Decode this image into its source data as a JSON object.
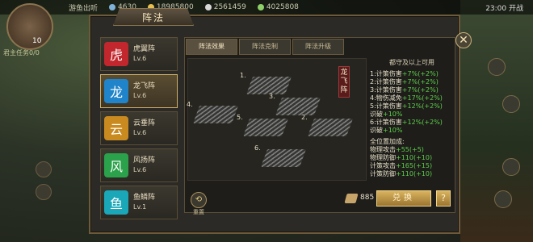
{
  "topbar": {
    "label": "游鱼出听",
    "res1": "4630",
    "res2": "18985800",
    "res3": "2561459",
    "res4": "4025808",
    "time": "23:00 开战"
  },
  "left": {
    "level": "10",
    "task": "君主任务0/0"
  },
  "panel": {
    "title": "阵法"
  },
  "formations": [
    {
      "name": "虎翼阵",
      "level": "Lv.6",
      "color": "#c1272d",
      "glyph": "虎"
    },
    {
      "name": "龙飞阵",
      "level": "Lv.6",
      "color": "#1f84c9",
      "glyph": "龙"
    },
    {
      "name": "云垂阵",
      "level": "Lv.6",
      "color": "#c98a1f",
      "glyph": "云"
    },
    {
      "name": "风扬阵",
      "level": "Lv.6",
      "color": "#2aa14a",
      "glyph": "风"
    },
    {
      "name": "鱼鳞阵",
      "level": "Lv.1",
      "color": "#1aa7b8",
      "glyph": "鱼"
    }
  ],
  "tabs": [
    "阵法效果",
    "阵法克制",
    "阵法升级"
  ],
  "formation_label": "龙飞阵",
  "positions": [
    "1.",
    "2.",
    "3.",
    "4.",
    "5.",
    "6."
  ],
  "stats": {
    "title": "都守及以上可用",
    "lines": [
      {
        "label": "1:计策伤害",
        "value": "+7%(+2%)"
      },
      {
        "label": "2:计策伤害",
        "value": "+7%(+2%)"
      },
      {
        "label": "3:计策伤害",
        "value": "+7%(+2%)"
      },
      {
        "label": "4:物伤减免",
        "value": "+17%(+2%)"
      },
      {
        "label": "5:计策伤害",
        "value": "+12%(+2%)"
      },
      {
        "label": "  识破",
        "value": "+10%"
      },
      {
        "label": "6:计策伤害",
        "value": "+12%(+2%)"
      },
      {
        "label": "  识破",
        "value": "+10%"
      }
    ],
    "all_title": "全位置加成:",
    "all": [
      {
        "label": "物理攻击",
        "value": "+55(+5)"
      },
      {
        "label": "物理防御",
        "value": "+110(+10)"
      },
      {
        "label": "计策攻击",
        "value": "+165(+15)"
      },
      {
        "label": "计策防御",
        "value": "+110(+10)"
      }
    ]
  },
  "bottom": {
    "reset_label": "重置",
    "cost": "885",
    "exchange_label": "兑换",
    "help_label": "?"
  },
  "colors": {
    "accent": "#d9b35e",
    "green": "#5dd04a"
  }
}
